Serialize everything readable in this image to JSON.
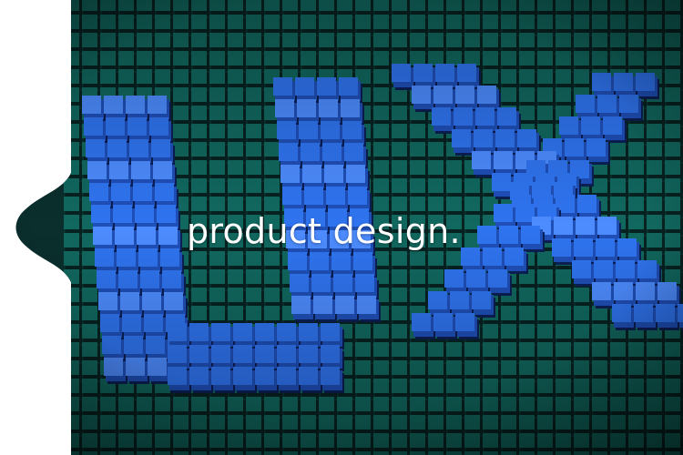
{
  "hero": {
    "caption": "product design.",
    "graphic_text": "UX",
    "icon": "pixel-cube-ux-graphic"
  },
  "colors": {
    "background": "#ffffff",
    "floor": "#0f5a52",
    "floor_dark": "#0a2f2d",
    "cube_floor": "#11685f",
    "cube_letter": "#2f74f0",
    "cube_letter_top": "#4d8cff",
    "caption": "#ffffff"
  }
}
